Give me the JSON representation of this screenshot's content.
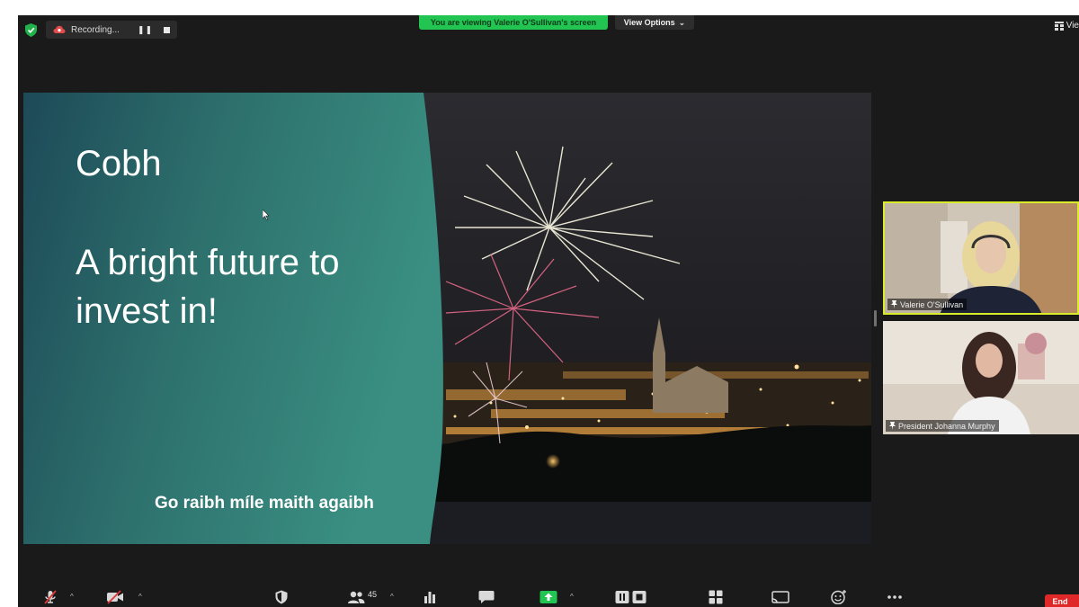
{
  "recording": {
    "label": "Recording..."
  },
  "banner": {
    "viewing_text": "You are viewing Valerie O'Sullivan's screen"
  },
  "view_options": {
    "label": "View Options",
    "caret": "⌄"
  },
  "view_top_right": {
    "label": "Vie"
  },
  "slide": {
    "title": "Cobh",
    "body": "A bright future to invest in!",
    "footer": "Go raibh míle maith agaibh"
  },
  "participants": [
    {
      "name": "Valerie O'Sullivan",
      "active_speaker": true
    },
    {
      "name": "President Johanna Murphy",
      "active_speaker": false
    }
  ],
  "toolbar": {
    "participant_count": "45",
    "end_label": "End"
  },
  "colors": {
    "banner_green": "#23c552",
    "active_speaker_border": "#d8ec2a",
    "end_red": "#e02828",
    "share_green": "#23c552",
    "slide_teal": "#2f7e76"
  },
  "icons": [
    "shield-icon",
    "recording-cloud-icon",
    "pause-icon",
    "stop-icon",
    "grid-view-icon",
    "pin-icon",
    "mic-muted-icon",
    "video-off-icon",
    "security-icon",
    "participants-icon",
    "polls-icon",
    "chat-icon",
    "share-screen-icon",
    "record-icon",
    "breakout-rooms-icon",
    "apps-icon",
    "immersive-view-icon",
    "reactions-icon",
    "more-icon"
  ]
}
